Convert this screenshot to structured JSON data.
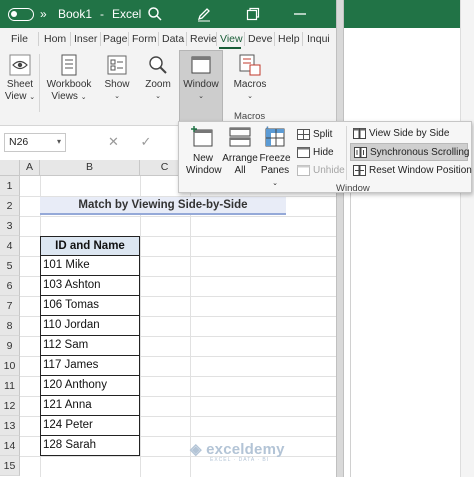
{
  "titlebar": {
    "overflow": "»",
    "book": "Book1",
    "sep": "-",
    "app": "Excel",
    "icons": [
      "search-icon",
      "pen-icon",
      "restore-icon",
      "window-icon"
    ]
  },
  "tabs": [
    "File",
    "Hom",
    "Inser",
    "Page",
    "Form",
    "Data",
    "Revie",
    "View",
    "Deve",
    "Help",
    "Inqui"
  ],
  "active_tab": "View",
  "ribbon": {
    "sheet_view": [
      "Sheet",
      "View"
    ],
    "workbook_views": [
      "Workbook",
      "Views"
    ],
    "show": "Show",
    "zoom": "Zoom",
    "window": "Window",
    "macros": "Macros",
    "macros_group": "Macros"
  },
  "namebox": "N26",
  "columns": [
    "A",
    "B",
    "C"
  ],
  "rows": [
    "1",
    "2",
    "3",
    "4",
    "5",
    "6",
    "7",
    "8",
    "9",
    "10",
    "11",
    "12",
    "13",
    "14",
    "15"
  ],
  "sheet": {
    "title": "Match by Viewing Side-by-Side",
    "table_header": "ID and Name",
    "rows": [
      "101 Mike",
      "103 Ashton",
      "106 Tomas",
      "110 Jordan",
      "112 Sam",
      "117 James",
      "120 Anthony",
      "121 Anna",
      "124 Peter",
      "128 Sarah"
    ]
  },
  "window_menu": {
    "new_window": [
      "New",
      "Window"
    ],
    "arrange_all": [
      "Arrange",
      "All"
    ],
    "freeze_panes": [
      "Freeze",
      "Panes"
    ],
    "split": "Split",
    "hide": "Hide",
    "unhide": "Unhide",
    "view_side_by_side": "View Side by Side",
    "synchronous_scrolling": "Synchronous Scrolling",
    "reset_window_position": "Reset Window Position",
    "group_label": "Window"
  },
  "watermark": {
    "name": "exceldemy",
    "tagline": "EXCEL · DATA · BI"
  },
  "colors": {
    "excel_green": "#217346",
    "header_fill": "#dce6f1",
    "title_fill": "#e8ecf7",
    "title_border": "#95a9d8"
  }
}
